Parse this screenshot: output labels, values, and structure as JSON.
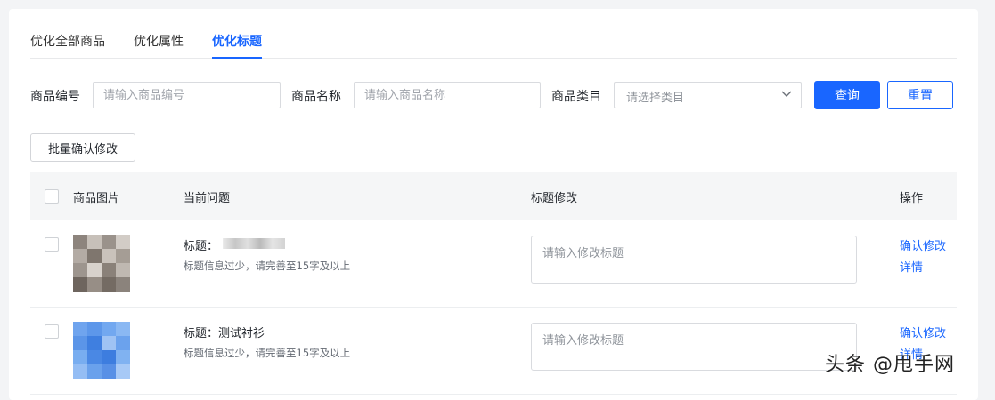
{
  "tabs": [
    {
      "label": "优化全部商品",
      "active": false
    },
    {
      "label": "优化属性",
      "active": false
    },
    {
      "label": "优化标题",
      "active": true
    }
  ],
  "filters": {
    "code_label": "商品编号",
    "code_placeholder": "请输入商品编号",
    "name_label": "商品名称",
    "name_placeholder": "请输入商品名称",
    "category_label": "商品类目",
    "category_placeholder": "请选择类目",
    "query_label": "查询",
    "reset_label": "重置"
  },
  "batch_label": "批量确认修改",
  "table": {
    "headers": {
      "image": "商品图片",
      "issue": "当前问题",
      "edit": "标题修改",
      "action": "操作"
    },
    "rows": [
      {
        "title": "标题：",
        "hint": "标题信息过少，请完善至15字及以上",
        "edit_placeholder": "请输入修改标题",
        "confirm_label": "确认修改",
        "detail_label": "详情"
      },
      {
        "title": "标题：测试衬衫",
        "hint": "标题信息过少，请完善至15字及以上",
        "edit_placeholder": "请输入修改标题",
        "confirm_label": "确认修改",
        "detail_label": "详情"
      }
    ]
  },
  "watermark": "头条 @甩手网",
  "colors": {
    "accent": "#1966ff"
  },
  "icons": {
    "select": "chevron-down-icon"
  }
}
